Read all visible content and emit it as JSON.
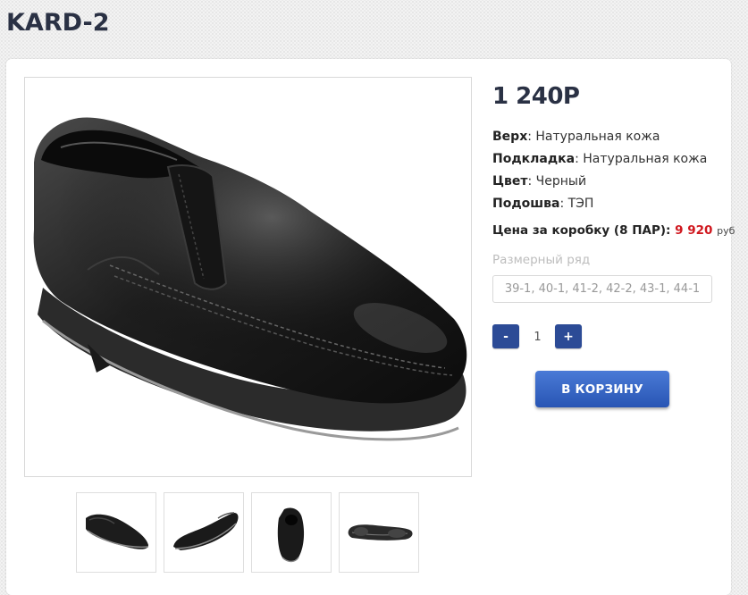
{
  "product": {
    "title": "KARD-2",
    "price": "1 240Р",
    "images": {
      "main": "black-leather-loafer-side-view",
      "thumbnails": [
        "shoe-side-view",
        "shoe-angled-view",
        "shoe-front-view",
        "shoe-sole-view"
      ]
    }
  },
  "specs": [
    {
      "label": "Верх",
      "value": "Натуральная кожа"
    },
    {
      "label": "Подкладка",
      "value": "Натуральная кожа"
    },
    {
      "label": "Цвет",
      "value": "Черный"
    },
    {
      "label": "Подошва",
      "value": "ТЭП"
    }
  ],
  "box_price": {
    "label": "Цена за коробку (8 ПАР):",
    "value": "9 920",
    "currency": "руб"
  },
  "sizes": {
    "label": "Размерный ряд",
    "selected": "39-1, 40-1, 41-2, 42-2, 43-1, 44-1"
  },
  "quantity": {
    "minus_label": "-",
    "value": "1",
    "plus_label": "+"
  },
  "cart": {
    "button_label": "В КОРЗИНУ"
  },
  "colors": {
    "title": "#2a3144",
    "accent_button": "#2c4b96",
    "cart_gradient_top": "#4a7ad6",
    "cart_gradient_bottom": "#2855b4",
    "box_price_value": "#d0181f"
  }
}
